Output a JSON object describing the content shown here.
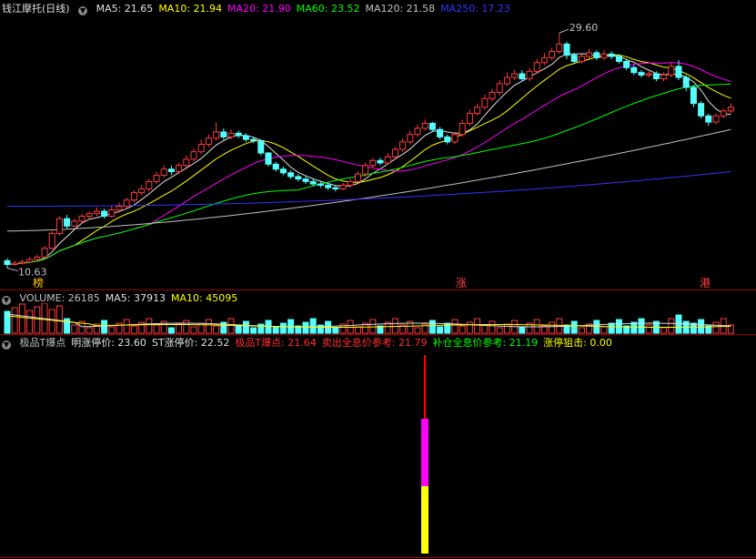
{
  "main_panel": {
    "title": "钱江摩托(日线)",
    "ma": [
      {
        "label": "MA5: 21.65",
        "color": "#e0e0e0"
      },
      {
        "label": "MA10: 21.94",
        "color": "#ffff00"
      },
      {
        "label": "MA20: 21.90",
        "color": "#ff00ff"
      },
      {
        "label": "MA60: 23.52",
        "color": "#00ff00"
      },
      {
        "label": "MA120: 21.58",
        "color": "#c0c0c0"
      },
      {
        "label": "MA250: 17.23",
        "color": "#3333ff"
      }
    ],
    "high_label": "29.60",
    "low_label": "10.63",
    "markers": [
      {
        "text": "榜",
        "color": "#ffcc00"
      },
      {
        "text": "涨",
        "color": "#ff4444"
      },
      {
        "text": "港",
        "color": "#ff4444"
      }
    ]
  },
  "volume_panel": {
    "items": [
      {
        "label": "VOLUME: 26185",
        "color": "#c0c0c0"
      },
      {
        "label": "MA5: 37913",
        "color": "#e0e0e0"
      },
      {
        "label": "MA10: 45095",
        "color": "#ffff00"
      }
    ]
  },
  "indicator_panel": {
    "items": [
      {
        "label": "极品T爆点",
        "color": "#c0c0c0"
      },
      {
        "label": "明涨停价: 23.60",
        "color": "#e0e0e0"
      },
      {
        "label": "ST涨停价: 22.52",
        "color": "#e0e0e0"
      },
      {
        "label": "极品T爆点: 21.64",
        "color": "#ff3030"
      },
      {
        "label": "卖出全息价参考: 21.79",
        "color": "#ff3030"
      },
      {
        "label": "补仓全息价参考: 21.19",
        "color": "#00ff00"
      },
      {
        "label": "涨停狙击: 0.00",
        "color": "#ffff00"
      }
    ]
  },
  "chart_data": {
    "type": "candlestick",
    "price_range": [
      10.63,
      29.6
    ],
    "candles": [
      [
        11.2,
        10.9,
        11.4,
        10.6
      ],
      [
        10.9,
        11.0,
        11.2,
        10.8
      ],
      [
        11.0,
        11.1,
        11.3,
        10.9
      ],
      [
        11.1,
        11.3,
        11.5,
        11.0
      ],
      [
        11.3,
        11.5,
        11.7,
        11.2
      ],
      [
        11.5,
        12.2,
        12.4,
        11.4
      ],
      [
        12.2,
        13.4,
        13.6,
        12.1
      ],
      [
        13.4,
        14.6,
        14.8,
        13.2
      ],
      [
        14.6,
        14.0,
        14.9,
        13.8
      ],
      [
        14.0,
        14.4,
        14.6,
        13.9
      ],
      [
        14.4,
        14.8,
        15.0,
        14.2
      ],
      [
        14.8,
        15.0,
        15.2,
        14.6
      ],
      [
        15.0,
        15.2,
        15.5,
        14.8
      ],
      [
        15.2,
        14.8,
        15.4,
        14.6
      ],
      [
        14.8,
        15.3,
        15.6,
        14.7
      ],
      [
        15.3,
        15.6,
        15.9,
        15.1
      ],
      [
        15.6,
        16.1,
        16.3,
        15.4
      ],
      [
        16.1,
        16.7,
        16.9,
        15.9
      ],
      [
        16.7,
        17.0,
        17.3,
        16.5
      ],
      [
        17.0,
        17.6,
        17.8,
        16.8
      ],
      [
        17.6,
        18.1,
        18.4,
        17.4
      ],
      [
        18.1,
        18.6,
        18.9,
        17.9
      ],
      [
        18.6,
        18.4,
        18.9,
        18.1
      ],
      [
        18.4,
        18.9,
        19.1,
        18.2
      ],
      [
        18.9,
        19.4,
        19.7,
        18.7
      ],
      [
        19.4,
        20.0,
        20.3,
        19.2
      ],
      [
        20.0,
        20.6,
        21.0,
        19.8
      ],
      [
        20.6,
        21.1,
        21.4,
        20.4
      ],
      [
        21.1,
        21.6,
        22.4,
        20.9
      ],
      [
        21.6,
        21.2,
        21.9,
        21.0
      ],
      [
        21.2,
        21.5,
        21.8,
        21.0
      ],
      [
        21.5,
        21.3,
        21.7,
        21.1
      ],
      [
        21.3,
        21.0,
        21.5,
        20.8
      ],
      [
        21.0,
        20.9,
        21.2,
        20.7
      ],
      [
        20.9,
        19.9,
        21.0,
        19.7
      ],
      [
        19.9,
        19.0,
        20.0,
        18.8
      ],
      [
        19.0,
        18.6,
        19.2,
        18.4
      ],
      [
        18.6,
        18.3,
        18.8,
        18.1
      ],
      [
        18.3,
        18.0,
        18.5,
        17.8
      ],
      [
        18.0,
        17.8,
        18.2,
        17.6
      ],
      [
        17.8,
        17.6,
        18.0,
        17.4
      ],
      [
        17.6,
        17.4,
        17.8,
        17.2
      ],
      [
        17.4,
        17.3,
        17.6,
        17.1
      ],
      [
        17.3,
        17.1,
        17.5,
        16.9
      ],
      [
        17.1,
        17.0,
        17.3,
        16.8
      ],
      [
        17.0,
        17.3,
        17.5,
        16.9
      ],
      [
        17.3,
        17.6,
        17.8,
        17.1
      ],
      [
        17.6,
        18.2,
        18.4,
        17.5
      ],
      [
        18.2,
        18.9,
        19.1,
        18.0
      ],
      [
        18.9,
        19.3,
        19.5,
        18.7
      ],
      [
        19.3,
        19.1,
        19.5,
        18.9
      ],
      [
        19.1,
        19.6,
        19.9,
        19.0
      ],
      [
        19.6,
        20.2,
        20.4,
        19.4
      ],
      [
        20.2,
        20.8,
        21.1,
        20.0
      ],
      [
        20.8,
        21.4,
        21.7,
        20.6
      ],
      [
        21.4,
        21.9,
        22.2,
        21.2
      ],
      [
        21.9,
        22.3,
        22.6,
        21.7
      ],
      [
        22.3,
        21.8,
        22.4,
        21.6
      ],
      [
        21.8,
        21.2,
        22.0,
        21.0
      ],
      [
        21.2,
        20.8,
        21.4,
        20.6
      ],
      [
        20.8,
        21.4,
        21.6,
        20.6
      ],
      [
        21.4,
        22.3,
        22.6,
        21.2
      ],
      [
        22.3,
        23.1,
        23.4,
        22.1
      ],
      [
        23.1,
        23.6,
        23.9,
        22.9
      ],
      [
        23.6,
        24.3,
        24.6,
        23.4
      ],
      [
        24.3,
        24.8,
        25.1,
        24.1
      ],
      [
        24.8,
        25.5,
        25.8,
        24.6
      ],
      [
        25.5,
        26.0,
        26.4,
        25.3
      ],
      [
        26.0,
        26.3,
        26.6,
        25.8
      ],
      [
        26.3,
        25.9,
        26.6,
        25.7
      ],
      [
        25.9,
        26.5,
        26.8,
        25.7
      ],
      [
        26.5,
        27.2,
        27.5,
        26.3
      ],
      [
        27.2,
        27.6,
        28.0,
        27.0
      ],
      [
        27.6,
        28.1,
        28.4,
        27.4
      ],
      [
        28.1,
        28.7,
        29.6,
        27.9
      ],
      [
        28.7,
        27.8,
        28.9,
        27.5
      ],
      [
        27.8,
        27.3,
        28.0,
        27.1
      ],
      [
        27.3,
        27.7,
        27.9,
        27.1
      ],
      [
        27.7,
        28.0,
        28.3,
        27.5
      ],
      [
        28.0,
        27.6,
        28.2,
        27.4
      ],
      [
        27.6,
        27.9,
        28.2,
        27.4
      ],
      [
        27.9,
        27.7,
        28.1,
        27.5
      ],
      [
        27.7,
        27.3,
        27.9,
        27.1
      ],
      [
        27.3,
        26.8,
        27.5,
        26.6
      ],
      [
        26.8,
        26.4,
        27.0,
        26.2
      ],
      [
        26.4,
        26.2,
        26.6,
        26.0
      ],
      [
        26.2,
        26.3,
        26.5,
        26.0
      ],
      [
        26.3,
        25.9,
        26.5,
        25.7
      ],
      [
        25.9,
        26.2,
        26.4,
        25.7
      ],
      [
        26.2,
        26.9,
        27.2,
        26.0
      ],
      [
        26.9,
        26.0,
        27.4,
        25.8
      ],
      [
        26.0,
        25.2,
        26.2,
        24.9
      ],
      [
        25.2,
        23.9,
        25.4,
        23.6
      ],
      [
        23.9,
        22.9,
        24.1,
        22.7
      ],
      [
        22.9,
        22.4,
        23.1,
        22.1
      ],
      [
        22.4,
        22.9,
        23.1,
        22.2
      ],
      [
        22.9,
        23.3,
        23.5,
        22.7
      ],
      [
        23.3,
        23.6,
        23.9,
        23.1
      ]
    ],
    "indicator_bar": [
      {
        "name": "极品T爆点",
        "value": 21.64,
        "color": "#ff0000"
      },
      {
        "name": "卖出全息价参考",
        "value": 21.79,
        "color": "#ff00ff"
      },
      {
        "name": "补仓全息价参考",
        "value": 21.19,
        "color": "#ffff00"
      }
    ]
  }
}
